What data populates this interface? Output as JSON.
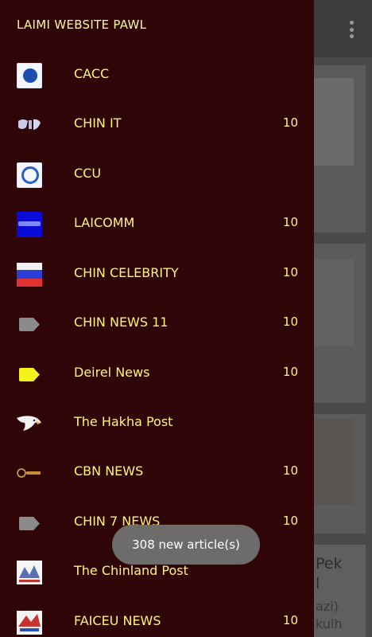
{
  "drawer": {
    "title": "LAIMI WEBSITE PAWL",
    "items": [
      {
        "label": "CACC",
        "count": "",
        "icon": "cacc-logo-icon"
      },
      {
        "label": "CHIN IT",
        "count": "10",
        "icon": "chin-it-logo-icon"
      },
      {
        "label": "CCU",
        "count": "",
        "icon": "ccu-logo-icon"
      },
      {
        "label": "LAICOMM",
        "count": "10",
        "icon": "laicomm-logo-icon"
      },
      {
        "label": "CHIN CELEBRITY",
        "count": "10",
        "icon": "chin-celebrity-flag-icon"
      },
      {
        "label": "CHIN NEWS 11",
        "count": "10",
        "icon": "gray-tag-icon"
      },
      {
        "label": "Deirel News",
        "count": "10",
        "icon": "yellow-tag-icon"
      },
      {
        "label": "The Hakha Post",
        "count": "",
        "icon": "eagle-icon"
      },
      {
        "label": "CBN NEWS",
        "count": "10",
        "icon": "cbn-logo-icon"
      },
      {
        "label": "CHIN 7 NEWS",
        "count": "10",
        "icon": "gray-tag-icon"
      },
      {
        "label": "The Chinland Post",
        "count": "",
        "icon": "chinland-post-logo-icon"
      },
      {
        "label": "FAICEU NEWS",
        "count": "10",
        "icon": "faiceu-logo-icon"
      }
    ]
  },
  "background": {
    "headline_fragment": "Pek",
    "headline_fragment_2": "l",
    "sub_fragment": "azi)",
    "sub_fragment_2": "kulh"
  },
  "toast": {
    "text": "308 new article(s)"
  },
  "colors": {
    "drawer_bg": "#2f0507",
    "text": "#fff47a",
    "toast_bg": "#6e6c6b"
  }
}
